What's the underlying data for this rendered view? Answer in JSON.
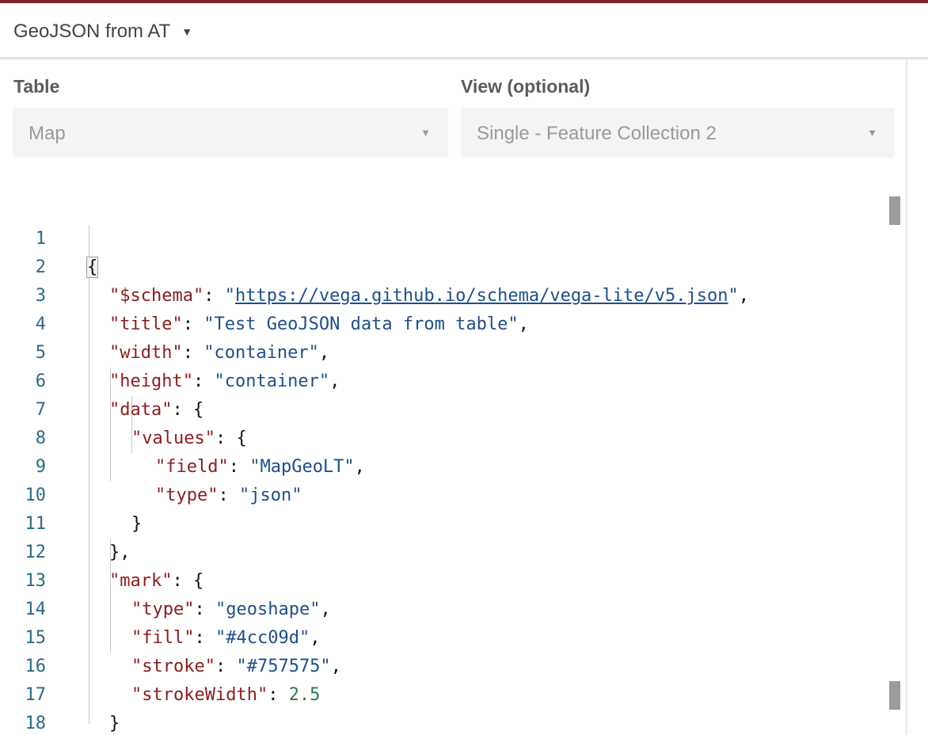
{
  "header": {
    "title": "GeoJSON from AT",
    "caret_icon": "caret-down-icon"
  },
  "table_field": {
    "label": "Table",
    "value": "Map"
  },
  "view_field": {
    "label": "View (optional)",
    "value": "Single - Feature Collection 2"
  },
  "editor": {
    "line_numbers": [
      "1",
      "2",
      "3",
      "4",
      "5",
      "6",
      "7",
      "8",
      "9",
      "10",
      "11",
      "12",
      "13",
      "14",
      "15",
      "16",
      "17",
      "18"
    ],
    "lines": {
      "l1": {
        "open": "{"
      },
      "l2": {
        "key": "\"$schema\"",
        "sep": ": ",
        "q1": "\"",
        "url": "https://vega.github.io/schema/vega-lite/v5.json",
        "q2": "\"",
        "end": ","
      },
      "l3": {
        "key": "\"title\"",
        "sep": ": ",
        "val": "\"Test GeoJSON data from table\"",
        "end": ","
      },
      "l4": {
        "key": "\"width\"",
        "sep": ": ",
        "val": "\"container\"",
        "end": ","
      },
      "l5": {
        "key": "\"height\"",
        "sep": ": ",
        "val": "\"container\"",
        "end": ","
      },
      "l6": {
        "key": "\"data\"",
        "sep": ": ",
        "end": "{"
      },
      "l7": {
        "key": "\"values\"",
        "sep": ": ",
        "end": "{"
      },
      "l8": {
        "key": "\"field\"",
        "sep": ": ",
        "val": "\"MapGeoLT\"",
        "end": ","
      },
      "l9": {
        "key": "\"type\"",
        "sep": ": ",
        "val": "\"json\""
      },
      "l10": {
        "close": "}"
      },
      "l11": {
        "close": "},"
      },
      "l12": {
        "key": "\"mark\"",
        "sep": ": ",
        "end": "{"
      },
      "l13": {
        "key": "\"type\"",
        "sep": ": ",
        "val": "\"geoshape\"",
        "end": ","
      },
      "l14": {
        "key": "\"fill\"",
        "sep": ": ",
        "val": "\"#4cc09d\"",
        "end": ","
      },
      "l15": {
        "key": "\"stroke\"",
        "sep": ": ",
        "val": "\"#757575\"",
        "end": ","
      },
      "l16": {
        "key": "\"strokeWidth\"",
        "sep": ": ",
        "num": "2.5"
      },
      "l17": {
        "close": "}"
      },
      "l18": {
        "close": "}"
      }
    }
  },
  "colors": {
    "accent": "#7a2230",
    "key": "#8b1d1d",
    "string": "#1f4e8c",
    "number": "#2c7a4b",
    "line_number": "#2d6a86"
  }
}
